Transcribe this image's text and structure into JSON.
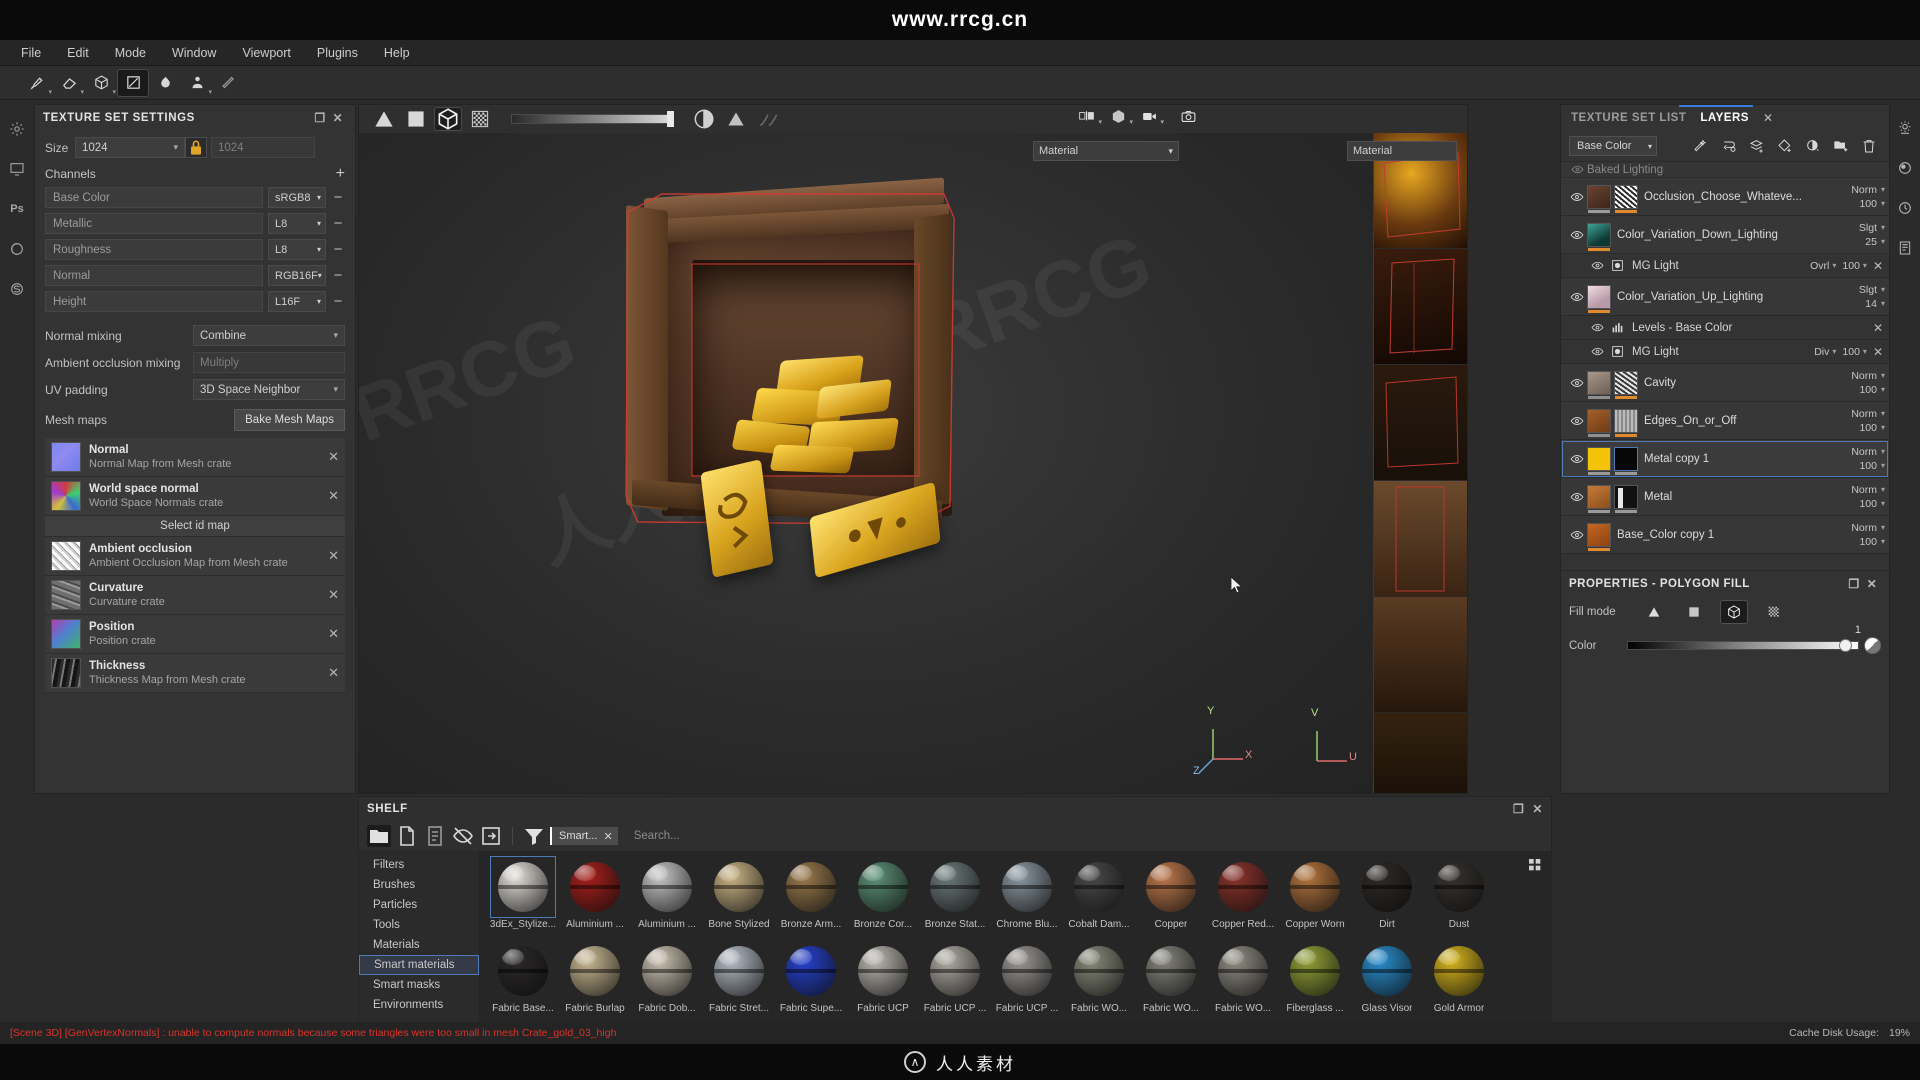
{
  "watermark": {
    "top": "www.rrcg.cn",
    "bottom": "人人素材",
    "ghost1": "RRCG",
    "ghost2": "人人素材"
  },
  "menubar": {
    "items": [
      "File",
      "Edit",
      "Mode",
      "Window",
      "Viewport",
      "Plugins",
      "Help"
    ]
  },
  "toolbar": {
    "tools": [
      {
        "name": "paint-brush-tool",
        "icon": "brush"
      },
      {
        "name": "eraser-tool",
        "icon": "eraser"
      },
      {
        "name": "projection-tool",
        "icon": "cube"
      },
      {
        "name": "polygon-fill-tool",
        "icon": "polyfill",
        "active": true
      },
      {
        "name": "smudge-tool",
        "icon": "smudge"
      },
      {
        "name": "clone-tool",
        "icon": "clone"
      },
      {
        "name": "material-picker-tool",
        "icon": "eyedropper"
      }
    ]
  },
  "left_rail": {
    "items": [
      {
        "name": "texture-set-settings-icon",
        "glyph": "gear"
      },
      {
        "name": "display-settings-icon",
        "glyph": "display"
      },
      {
        "name": "photoshop-export-icon",
        "glyph": "Ps"
      },
      {
        "name": "shader-settings-icon",
        "glyph": "shader"
      },
      {
        "name": "substance-icon",
        "glyph": "sub"
      }
    ]
  },
  "texture_set_settings": {
    "title": "TEXTURE SET SETTINGS",
    "size_label": "Size",
    "size_value": "1024",
    "size_value_locked": "1024",
    "lock_icon": "lock-icon",
    "channels_label": "Channels",
    "add_channel": "+",
    "channels": [
      {
        "name": "Base Color",
        "format": "sRGB8"
      },
      {
        "name": "Metallic",
        "format": "L8"
      },
      {
        "name": "Roughness",
        "format": "L8"
      },
      {
        "name": "Normal",
        "format": "RGB16F"
      },
      {
        "name": "Height",
        "format": "L16F"
      }
    ],
    "mixing": [
      {
        "label": "Normal mixing",
        "value": "Combine",
        "dim": false
      },
      {
        "label": "Ambient occlusion mixing",
        "value": "Multiply",
        "dim": true
      },
      {
        "label": "UV padding",
        "value": "3D Space Neighbor",
        "dim": false
      }
    ],
    "mesh_maps_label": "Mesh maps",
    "bake_button": "Bake Mesh Maps",
    "select_id_map": "Select id map",
    "mesh_maps": [
      {
        "title": "Normal",
        "subtitle": "Normal Map from Mesh crate",
        "thumb": "normal-map"
      },
      {
        "title": "World space normal",
        "subtitle": "World Space Normals crate",
        "thumb": "wsnormal-map"
      },
      {
        "title": "Ambient occlusion",
        "subtitle": "Ambient Occlusion Map from Mesh crate",
        "thumb": "ao-map"
      },
      {
        "title": "Curvature",
        "subtitle": "Curvature crate",
        "thumb": "curvature-map"
      },
      {
        "title": "Position",
        "subtitle": "Position crate",
        "thumb": "position-map"
      },
      {
        "title": "Thickness",
        "subtitle": "Thickness Map from Mesh crate",
        "thumb": "thickness-map"
      }
    ]
  },
  "viewport": {
    "mode_buttons": [
      {
        "name": "triangle-fill-mode",
        "active": false
      },
      {
        "name": "square-fill-mode",
        "active": false
      },
      {
        "name": "mesh-fill-mode",
        "active": true
      },
      {
        "name": "uv-fill-mode",
        "active": false
      }
    ],
    "slider_value": "1",
    "right_icons": [
      {
        "name": "dual-view-icon"
      },
      {
        "name": "3d-view-icon"
      },
      {
        "name": "camera-video-icon"
      },
      {
        "name": "screenshot-icon"
      }
    ],
    "material_combo": "Material",
    "material_combo_2d": "Material",
    "axis": {
      "x": "X",
      "y": "Y",
      "z": "Z",
      "u": "U",
      "v": "V"
    }
  },
  "shelf": {
    "title": "SHELF",
    "toolbar": [
      {
        "name": "folder-icon",
        "active": true
      },
      {
        "name": "new-file-icon",
        "active": false
      },
      {
        "name": "list-view-icon",
        "active": false
      },
      {
        "name": "hide-icon",
        "active": false
      },
      {
        "name": "import-icon",
        "active": false
      }
    ],
    "filter_icon": "filter-icon",
    "chip": "Smart...",
    "chip_close": "✕",
    "search_placeholder": "Search...",
    "categories": [
      {
        "label": "Filters",
        "selected": false
      },
      {
        "label": "Brushes",
        "selected": false
      },
      {
        "label": "Particles",
        "selected": false
      },
      {
        "label": "Tools",
        "selected": false
      },
      {
        "label": "Materials",
        "selected": false
      },
      {
        "label": "Smart materials",
        "selected": true
      },
      {
        "label": "Smart masks",
        "selected": false
      },
      {
        "label": "Environments",
        "selected": false
      }
    ],
    "materials": [
      {
        "label": "3dEx_Stylize...",
        "color": "#e6e2dc",
        "selected": true
      },
      {
        "label": "Aluminium ...",
        "color": "#a8201c",
        "selected": false
      },
      {
        "label": "Aluminium ...",
        "color": "#c9c9cb",
        "selected": false
      },
      {
        "label": "Bone Stylized",
        "color": "#cdb687",
        "selected": false
      },
      {
        "label": "Bronze Arm...",
        "color": "#9d7c4e",
        "selected": false
      },
      {
        "label": "Bronze Cor...",
        "color": "#5e9379",
        "selected": false
      },
      {
        "label": "Bronze Stat...",
        "color": "#6e7b7c",
        "selected": false
      },
      {
        "label": "Chrome Blu...",
        "color": "#8e9aa4",
        "selected": false
      },
      {
        "label": "Cobalt Dam...",
        "color": "#4a4a4c",
        "selected": false
      },
      {
        "label": "Copper",
        "color": "#c07a4d",
        "selected": false
      },
      {
        "label": "Copper Red...",
        "color": "#8c342c",
        "selected": false
      },
      {
        "label": "Copper Worn",
        "color": "#b5763f",
        "selected": false
      },
      {
        "label": "Dirt",
        "color": "#2e2a27",
        "selected": false
      },
      {
        "label": "Dust",
        "color": "#37332f",
        "selected": false
      },
      {
        "label": "Fabric Base...",
        "color": "#2c2a29",
        "selected": false
      },
      {
        "label": "Fabric Burlap",
        "color": "#cbbb95",
        "selected": false
      },
      {
        "label": "Fabric Dob...",
        "color": "#cdc3b4",
        "selected": false
      },
      {
        "label": "Fabric Stret...",
        "color": "#b7bfc8",
        "selected": false
      },
      {
        "label": "Fabric Supe...",
        "color": "#2743d0",
        "selected": false
      },
      {
        "label": "Fabric UCP",
        "color": "#bdb9b2",
        "selected": false
      },
      {
        "label": "Fabric UCP ...",
        "color": "#b2aea6",
        "selected": false
      },
      {
        "label": "Fabric UCP ...",
        "color": "#9d9a96",
        "selected": false
      },
      {
        "label": "Fabric WO...",
        "color": "#8b8c7c",
        "selected": false
      },
      {
        "label": "Fabric WO...",
        "color": "#87867e",
        "selected": false
      },
      {
        "label": "Fabric WO...",
        "color": "#918e85",
        "selected": false
      },
      {
        "label": "Fiberglass ...",
        "color": "#93a238",
        "selected": false
      },
      {
        "label": "Glass Visor",
        "color": "#2a8fd0",
        "selected": false
      },
      {
        "label": "Gold Armor",
        "color": "#d8b61e",
        "selected": false
      }
    ],
    "grid_toggle": "grid-view-icon"
  },
  "right_panel": {
    "tabs": [
      {
        "label": "TEXTURE SET LIST",
        "selected": false
      },
      {
        "label": "LAYERS",
        "selected": true
      }
    ],
    "tab_close": "✕",
    "channel_combo": "Base Color",
    "toolbar_icons": [
      {
        "name": "add-smart-material-icon"
      },
      {
        "name": "add-fill-layer-icon"
      },
      {
        "name": "add-paint-layer-icon"
      },
      {
        "name": "add-mask-icon"
      },
      {
        "name": "add-effect-icon"
      },
      {
        "name": "add-folder-icon"
      },
      {
        "name": "delete-layer-icon"
      }
    ],
    "layers": [
      {
        "type": "partial",
        "name": "Baked Lighting"
      },
      {
        "type": "layer",
        "name": "Occlusion_Choose_Whateve...",
        "blend": "Norm",
        "opacity": "100",
        "visible": true,
        "selected": false,
        "thumb1": "#5a3a2e",
        "thumb2": "#d8d8d8",
        "bar1": "#9a9a9a",
        "bar2": "#e08a2e",
        "has_mask": true
      },
      {
        "type": "layer",
        "name": "Color_Variation_Down_Lighting",
        "blend": "Slgt",
        "opacity": "25",
        "visible": true,
        "selected": false,
        "thumb1": "#2e8b82",
        "bar1": "#e08a2e",
        "has_mask": false
      },
      {
        "type": "effect",
        "name": "MG Light",
        "icon": "generator-icon",
        "blend": "Ovrl",
        "opacity": "100",
        "visible": true
      },
      {
        "type": "layer",
        "name": "Color_Variation_Up_Lighting",
        "blend": "Slgt",
        "opacity": "14",
        "visible": true,
        "selected": false,
        "thumb1": "#e6c8d2",
        "bar1": "#e08a2e",
        "has_mask": false
      },
      {
        "type": "effect",
        "name": "Levels - Base Color",
        "icon": "levels-icon",
        "blend": "",
        "opacity": "",
        "visible": true
      },
      {
        "type": "effect",
        "name": "MG Light",
        "icon": "generator-icon",
        "blend": "Div",
        "opacity": "100",
        "visible": true
      },
      {
        "type": "layer",
        "name": "Cavity",
        "blend": "Norm",
        "opacity": "100",
        "visible": true,
        "selected": false,
        "thumb1": "#8c8279",
        "thumb2": "#cfcfcf",
        "bar1": "#8f8f8f",
        "bar2": "#e08a2e",
        "has_mask": true
      },
      {
        "type": "layer",
        "name": "Edges_On_or_Off",
        "blend": "Norm",
        "opacity": "100",
        "visible": true,
        "selected": false,
        "thumb1": "#8a4a20",
        "thumb2": "#9e9e9e",
        "bar1": "#8f8f8f",
        "bar2": "#e08a2e",
        "has_mask": true
      },
      {
        "type": "layer",
        "name": "Metal copy 1",
        "blend": "Norm",
        "opacity": "100",
        "visible": true,
        "selected": true,
        "thumb1": "#f5c20a",
        "thumb2": "#070707",
        "bar1": "#9a9a9a",
        "bar2": "#9a9a9a",
        "has_mask": true
      },
      {
        "type": "layer",
        "name": "Metal",
        "blend": "Norm",
        "opacity": "100",
        "visible": true,
        "selected": false,
        "thumb1": "#b2writ",
        "thumb2": "#111111",
        "bar1": "#9a9a9a",
        "bar2": "#9a9a9a",
        "has_mask": true
      },
      {
        "type": "layer",
        "name": "Base_Color copy 1",
        "blend": "Norm",
        "opacity": "100",
        "visible": true,
        "selected": false,
        "thumb1": "#b5561c",
        "bar1": "#e08a2e",
        "has_mask": false
      }
    ]
  },
  "properties": {
    "title": "PROPERTIES - POLYGON FILL",
    "fill_mode_label": "Fill mode",
    "fill_modes": [
      {
        "name": "triangle-fill",
        "active": false
      },
      {
        "name": "uv-quad-fill",
        "active": false
      },
      {
        "name": "mesh-fill",
        "active": true
      },
      {
        "name": "uv-chunk-fill",
        "active": false
      }
    ],
    "color_label": "Color",
    "color_value": "1"
  },
  "right_rail": {
    "items": [
      {
        "name": "display-settings-icon"
      },
      {
        "name": "shader-settings-icon"
      },
      {
        "name": "history-icon"
      },
      {
        "name": "log-icon"
      }
    ]
  },
  "statusbar": {
    "error": "[Scene 3D] [GenVertexNormals] : unable to compute normals because some triangles were too small in mesh Crate_gold_03_high",
    "cache_label": "Cache Disk Usage:",
    "cache_value": "19%"
  }
}
